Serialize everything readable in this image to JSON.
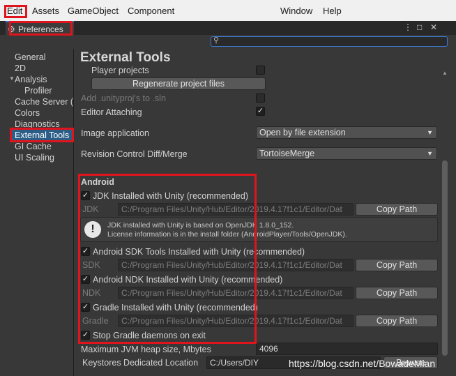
{
  "menubar": {
    "items": [
      "Edit",
      "Assets",
      "GameObject",
      "Component",
      "Window",
      "Help"
    ]
  },
  "window": {
    "tab_title": "Preferences",
    "buttons": [
      "⋮",
      "□",
      "✕"
    ]
  },
  "search": {
    "placeholder": ""
  },
  "sidebar": {
    "items": [
      "General",
      "2D",
      "Analysis",
      "Profiler",
      "Cache Server (",
      "Colors",
      "Diagnostics",
      "External Tools",
      "GI Cache",
      "UI Scaling"
    ],
    "selected": "External Tools"
  },
  "main": {
    "title": "External Tools",
    "player_projects": "Player projects",
    "regenerate_button": "Regenerate project files",
    "add_unityproj": "Add .unityproj's to .sln",
    "editor_attaching": "Editor Attaching",
    "image_application_label": "Image application",
    "image_application_value": "Open by file extension",
    "revision_label": "Revision Control Diff/Merge",
    "revision_value": "TortoiseMerge",
    "android": {
      "header": "Android",
      "jdk_toggle": "JDK Installed with Unity (recommended)",
      "jdk_label": "JDK",
      "jdk_path": "C:/Program Files/Unity/Hub/Editor/2019.4.17f1c1/Editor/Dat",
      "help_line1": "JDK installed with Unity is based on OpenJDK 1.8.0_152.",
      "help_line2": "License information is in the install folder (AndroidPlayer/Tools/OpenJDK).",
      "sdk_toggle": "Android SDK Tools Installed with Unity (recommended)",
      "sdk_label": "SDK",
      "sdk_path": "C:/Program Files/Unity/Hub/Editor/2019.4.17f1c1/Editor/Dat",
      "ndk_toggle": "Android NDK Installed with Unity (recommended)",
      "ndk_label": "NDK",
      "ndk_path": "C:/Program Files/Unity/Hub/Editor/2019.4.17f1c1/Editor/Dat",
      "gradle_toggle": "Gradle Installed with Unity (recommended)",
      "gradle_label": "Gradle",
      "gradle_path": "C:/Program Files/Unity/Hub/Editor/2019.4.17f1c1/Editor/Dat",
      "copy_path": "Copy Path",
      "stop_gradle": "Stop Gradle daemons on exit",
      "max_jvm_label": "Maximum JVM heap size, Mbytes",
      "max_jvm_value": "4096",
      "keystores_label": "Keystores Dedicated Location",
      "keystores_value": "C:/Users/DIY",
      "browse": "Browse"
    }
  },
  "watermark": "https://blog.csdn.net/BowadeMian",
  "colors": {
    "highlight": "#e0141c",
    "selection": "#2c5d87",
    "accent": "#3a7bd5"
  },
  "icons": [
    "gear-icon",
    "search-icon",
    "info-icon",
    "check-icon",
    "dropdown-caret-icon"
  ]
}
